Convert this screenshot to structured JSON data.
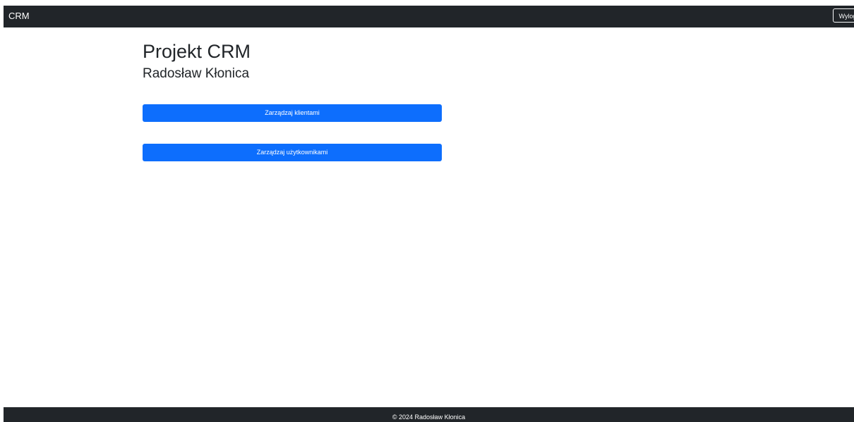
{
  "navbar": {
    "brand": "CRM",
    "logout_label": "Wylog"
  },
  "main": {
    "title": "Projekt CRM",
    "subtitle": "Radosław Kłonica",
    "buttons": [
      {
        "label": "Zarządzaj klientami"
      },
      {
        "label": "Zarządzaj użytkownikami"
      }
    ]
  },
  "footer": {
    "text": "© 2024 Radosław Kłonica"
  },
  "colors": {
    "navbar_bg": "#212529",
    "primary_button": "#0d6efd",
    "text": "#212529",
    "footer_bg": "#212529"
  }
}
